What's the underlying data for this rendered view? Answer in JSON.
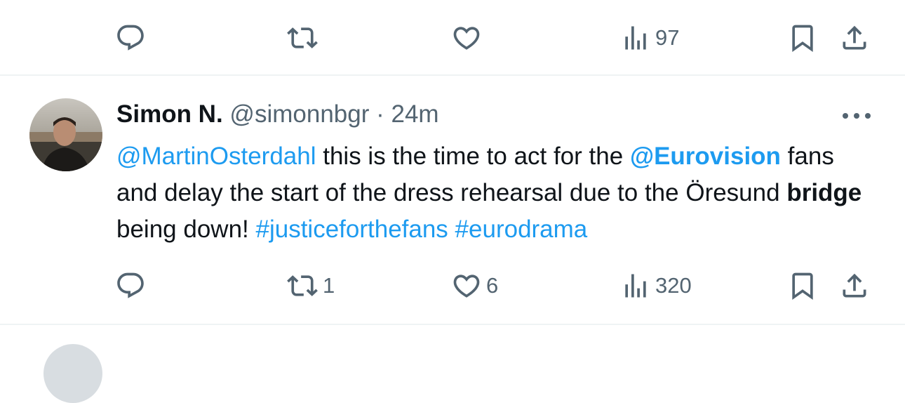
{
  "top_actions": {
    "reply_count": "",
    "retweet_count": "",
    "like_count": "",
    "views_count": "97"
  },
  "tweet": {
    "display_name": "Simon N.",
    "handle": "@simonnbgr",
    "separator": " · ",
    "time": "24m",
    "text": {
      "mention1": "@MartinOsterdahl",
      "part1": " this is the time to act for the ",
      "mention2": "@Eurovision",
      "part2": " fans and delay the start of the dress rehearsal due to the Öresund ",
      "bold_word": "bridge",
      "part3": " being down! ",
      "hashtag1": "#justiceforthefans",
      "space": " ",
      "hashtag2": "#eurodrama"
    },
    "actions": {
      "reply_count": "",
      "retweet_count": "1",
      "like_count": "6",
      "views_count": "320"
    }
  },
  "colors": {
    "icon_gray": "#536471",
    "link_blue": "#1d9bf0",
    "divider": "#eff3f4"
  }
}
